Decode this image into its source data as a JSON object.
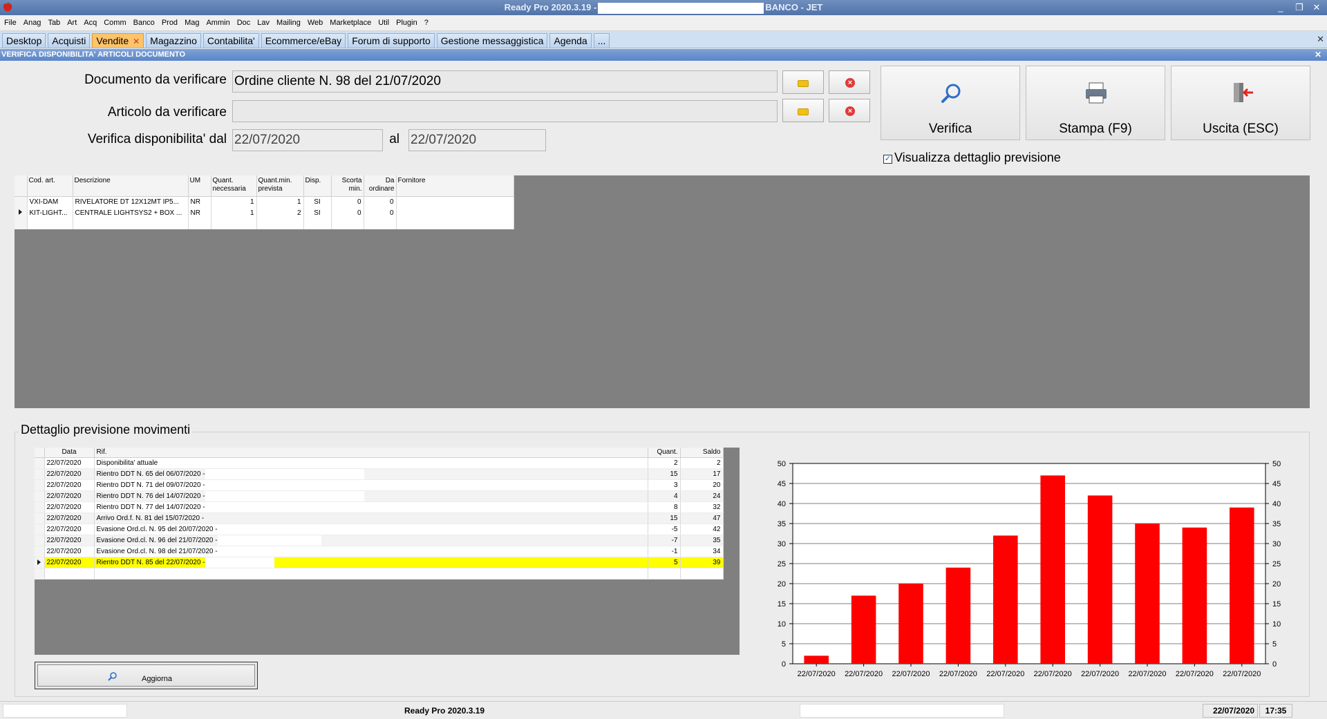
{
  "titlebar": {
    "title_left": "Ready Pro 2020.3.19 -",
    "title_right": "BANCO - JET",
    "minimize": "_",
    "restore": "❐",
    "close": "✕"
  },
  "menu": [
    "File",
    "Anag",
    "Tab",
    "Art",
    "Acq",
    "Comm",
    "Banco",
    "Prod",
    "Mag",
    "Ammin",
    "Doc",
    "Lav",
    "Mailing",
    "Web",
    "Marketplace",
    "Util",
    "Plugin",
    "?"
  ],
  "tabs": [
    "Desktop",
    "Acquisti",
    "Vendite",
    "Magazzino",
    "Contabilita'",
    "Ecommerce/eBay",
    "Forum di supporto",
    "Gestione messaggistica",
    "Agenda",
    "..."
  ],
  "active_tab_index": 2,
  "window_caption": "VERIFICA DISPONIBILITA' ARTICOLI DOCUMENTO",
  "form": {
    "documento_label": "Documento da verificare",
    "documento_value": "Ordine cliente N. 98 del 21/07/2020",
    "articolo_label": "Articolo da verificare",
    "articolo_value": "",
    "verifica_dal_label": "Verifica disponibilita' dal",
    "dal_value": "22/07/2020",
    "al_label": "al",
    "al_value": "22/07/2020"
  },
  "buttons": {
    "verifica": "Verifica",
    "stampa": "Stampa (F9)",
    "uscita": "Uscita (ESC)",
    "aggiorna": "Aggiorna"
  },
  "checkbox": {
    "label": "Visualizza dettaglio previsione",
    "checked": true,
    "mark": "✓"
  },
  "articles_table": {
    "headers": [
      "Cod. art.",
      "Descrizione",
      "UM",
      "Quant. necessaria",
      "Quant.min. prevista",
      "Disp.",
      "Scorta min.",
      "Da ordinare",
      "Fornitore"
    ],
    "rows": [
      [
        "VXI-DAM",
        "RIVELATORE DT 12X12MT IP5...",
        "NR",
        "1",
        "1",
        "SI",
        "0",
        "0",
        ""
      ],
      [
        "KIT-LIGHT...",
        "CENTRALE LIGHTSYS2 + BOX ...",
        "NR",
        "1",
        "2",
        "SI",
        "0",
        "0",
        ""
      ]
    ],
    "selected_row": 1
  },
  "detail": {
    "title": "Dettaglio previsione movimenti",
    "headers": [
      "Data",
      "Rif.",
      "Quant.",
      "Saldo"
    ],
    "rows": [
      [
        "22/07/2020",
        "Disponibilita' attuale",
        "2",
        "2"
      ],
      [
        "22/07/2020",
        "Rientro DDT N. 65 del 06/07/2020 -",
        "15",
        "17"
      ],
      [
        "22/07/2020",
        "Rientro DDT N. 71 del 09/07/2020 -",
        "3",
        "20"
      ],
      [
        "22/07/2020",
        "Rientro DDT N. 76 del 14/07/2020 -",
        "4",
        "24"
      ],
      [
        "22/07/2020",
        "Rientro DDT N. 77 del 14/07/2020 -",
        "8",
        "32"
      ],
      [
        "22/07/2020",
        "Arrivo Ord.f. N. 81 del 15/07/2020 -",
        "15",
        "47"
      ],
      [
        "22/07/2020",
        "Evasione Ord.cl. N. 95 del 20/07/2020 -",
        "-5",
        "42"
      ],
      [
        "22/07/2020",
        "Evasione Ord.cl. N. 96 del 21/07/2020 -",
        "-7",
        "35"
      ],
      [
        "22/07/2020",
        "Evasione Ord.cl. N. 98 del 21/07/2020 -",
        "-1",
        "34"
      ],
      [
        "22/07/2020",
        "Rientro DDT N. 85 del 22/07/2020 -",
        "5",
        "39"
      ]
    ],
    "selected_row": 9
  },
  "chart_data": {
    "type": "bar",
    "categories": [
      "22/07/2020",
      "22/07/2020",
      "22/07/2020",
      "22/07/2020",
      "22/07/2020",
      "22/07/2020",
      "22/07/2020",
      "22/07/2020",
      "22/07/2020",
      "22/07/2020"
    ],
    "values": [
      2,
      17,
      20,
      24,
      32,
      47,
      42,
      35,
      34,
      39
    ],
    "yticks": [
      "0",
      "5",
      "10",
      "15",
      "20",
      "25",
      "30",
      "35",
      "40",
      "45",
      "50"
    ],
    "ylim": [
      0,
      50
    ],
    "title": "",
    "xlabel": "",
    "ylabel": "",
    "grid": true,
    "legend": "none",
    "bar_color": "#ff0000"
  },
  "statusbar": {
    "version": "Ready Pro 2020.3.19",
    "date": "22/07/2020",
    "time": "17:35"
  },
  "colors": {
    "active_tab": "#ffc36a",
    "highlight_row": "#ffff00",
    "grid_background": "#808080",
    "titlebar": "#4f72a8"
  }
}
